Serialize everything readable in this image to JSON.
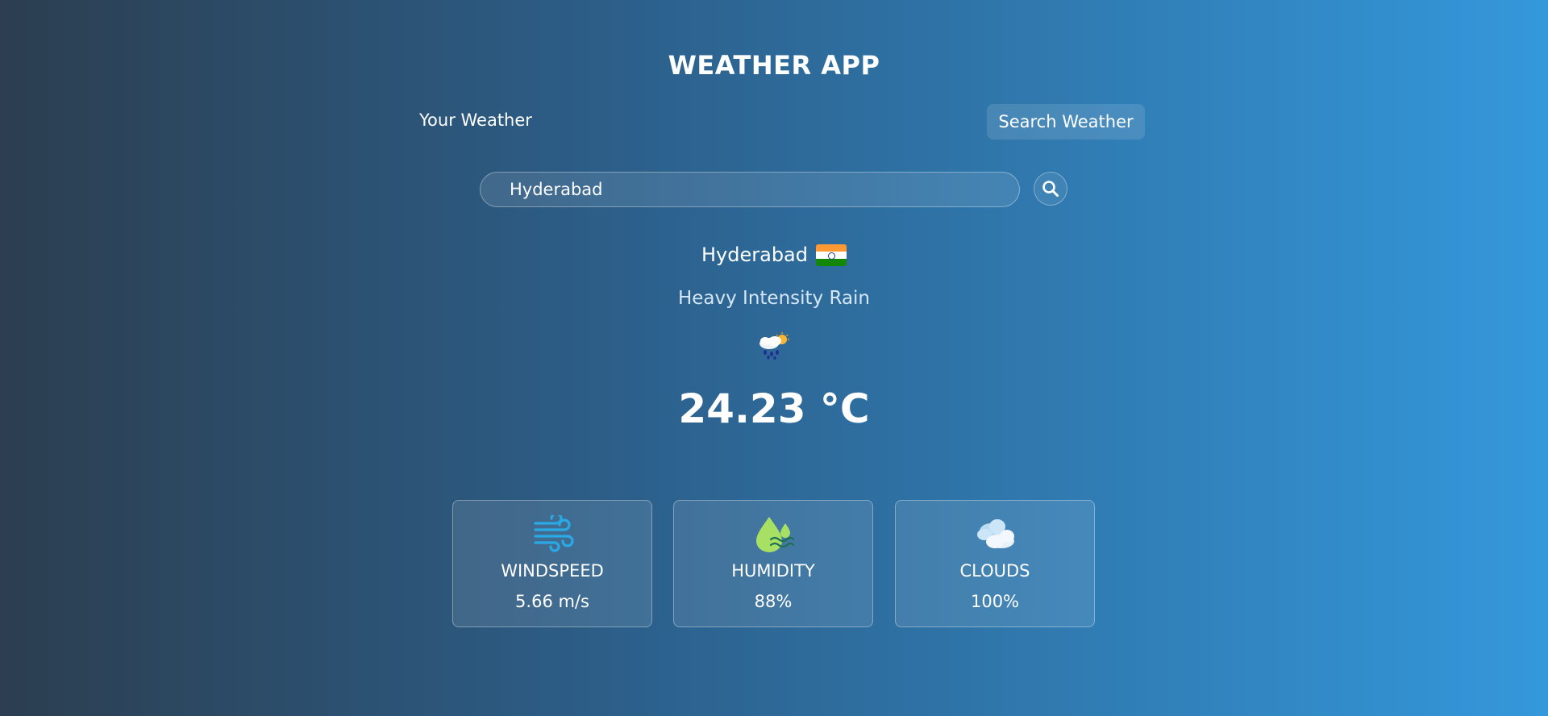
{
  "header": {
    "title": "WEATHER APP"
  },
  "tabs": {
    "your_weather": "Your Weather",
    "search_weather": "Search Weather"
  },
  "search": {
    "value": "Hyderabad",
    "icon": "search-icon"
  },
  "current": {
    "city": "Hyderabad",
    "country_flag": "india-flag",
    "description": "Heavy Intensity Rain",
    "condition_icon": "rain-cloud-sun-icon",
    "temperature": "24.23 °C"
  },
  "stats": {
    "wind": {
      "icon": "wind-icon",
      "label": "WINDSPEED",
      "value": "5.66 m/s"
    },
    "humidity": {
      "icon": "humidity-droplet-icon",
      "label": "HUMIDITY",
      "value": "88%"
    },
    "clouds": {
      "icon": "cloud-icon",
      "label": "CLOUDS",
      "value": "100%"
    }
  },
  "colors": {
    "background_start": "#2c3e50",
    "background_end": "#3498db",
    "text": "#ffffff",
    "flag_saffron": "#ff9933",
    "flag_white": "#ffffff",
    "flag_green": "#138808"
  }
}
